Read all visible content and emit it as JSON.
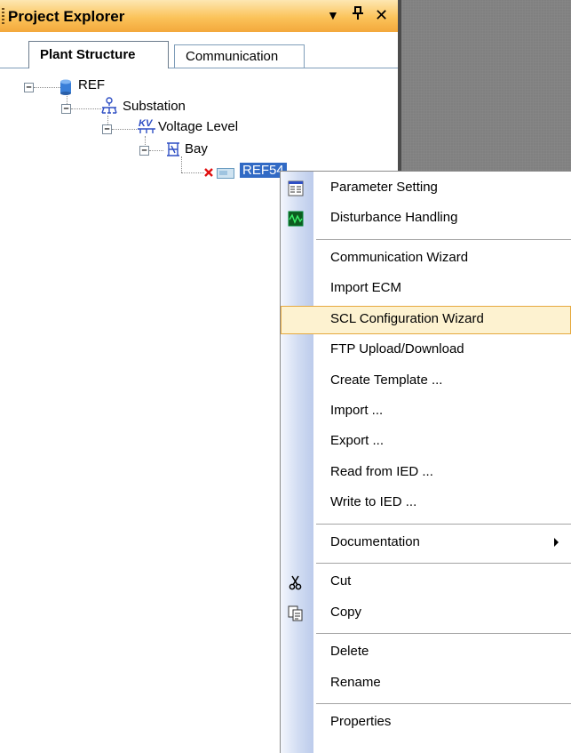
{
  "panel": {
    "title": "Project Explorer",
    "dropdown_glyph": "▼",
    "pin_glyph": "ᵖ",
    "close_glyph": "✕"
  },
  "tabs": [
    {
      "label": "Plant Structure",
      "active": true
    },
    {
      "label": "Communication",
      "active": false
    }
  ],
  "tree": {
    "root": {
      "label": "REF",
      "icon": "database-icon"
    },
    "substation": {
      "label": "Substation",
      "icon": "substation-icon"
    },
    "voltage_level": {
      "label": "Voltage Level",
      "icon": "voltage-level-icon",
      "icon_text": "KV"
    },
    "bay": {
      "label": "Bay",
      "icon": "bay-icon"
    },
    "ied": {
      "label": "REF54",
      "icon": "ied-icon",
      "status_icon": "error-x-icon",
      "selected": true
    }
  },
  "context_menu": {
    "groups": [
      [
        {
          "label": "Parameter Setting",
          "icon": "parameter-setting-icon"
        },
        {
          "label": "Disturbance Handling",
          "icon": "disturbance-handling-icon"
        }
      ],
      [
        {
          "label": "Communication Wizard"
        },
        {
          "label": "Import ECM"
        },
        {
          "label": "SCL Configuration Wizard",
          "hovered": true
        },
        {
          "label": "FTP Upload/Download"
        },
        {
          "label": "Create Template ..."
        },
        {
          "label": "Import ..."
        },
        {
          "label": "Export ..."
        },
        {
          "label": "Read from IED ..."
        },
        {
          "label": "Write to IED ..."
        }
      ],
      [
        {
          "label": "Documentation",
          "has_submenu": true
        }
      ],
      [
        {
          "label": "Cut",
          "icon": "scissors-icon"
        },
        {
          "label": "Copy",
          "icon": "copy-icon"
        }
      ],
      [
        {
          "label": "Delete"
        },
        {
          "label": "Rename"
        }
      ],
      [
        {
          "label": "Properties"
        }
      ]
    ]
  },
  "colors": {
    "titlebar_top": "#fde7b2",
    "titlebar_bottom": "#f3a83b",
    "selection": "#316ac5",
    "menu_hover_bg": "#fdf2d0",
    "menu_hover_border": "#e6a93f",
    "workspace": "#808080"
  }
}
